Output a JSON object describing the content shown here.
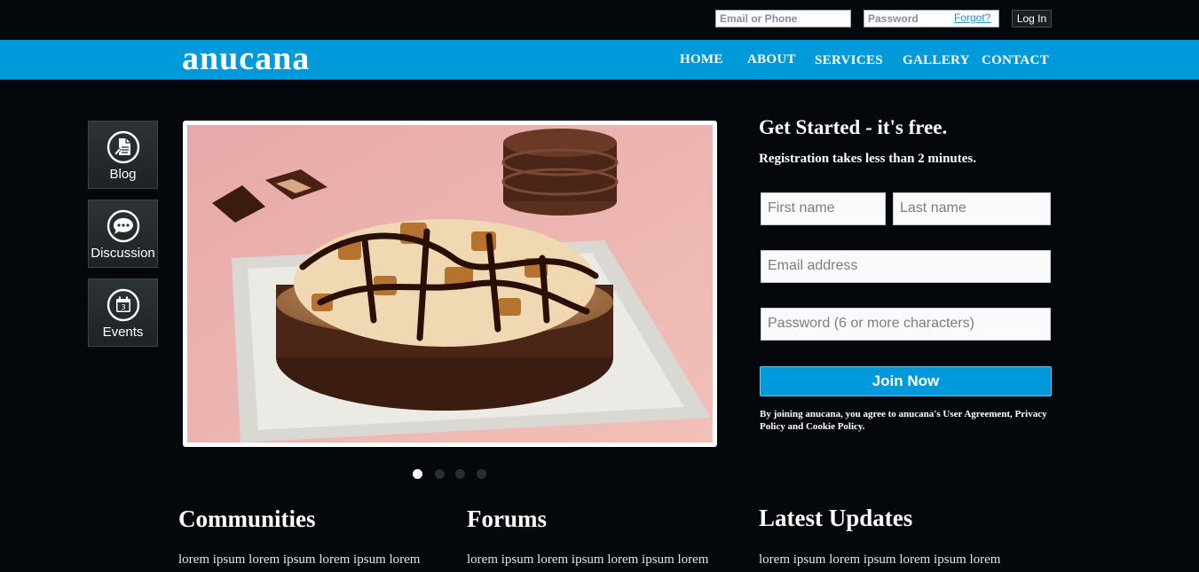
{
  "topbar": {
    "email_placeholder": "Email or Phone",
    "password_placeholder": "Password",
    "forgot_label": "Forgot?",
    "login_label": "Log In"
  },
  "navbar": {
    "logo": "anucana",
    "items": [
      "HOME",
      "ABOUT",
      "SERVICES",
      "GALLERY",
      "CONTACT"
    ]
  },
  "sidebar": {
    "tiles": [
      {
        "label": "Blog",
        "icon": "blog-document-icon"
      },
      {
        "label": "Discussion",
        "icon": "chat-bubble-icon"
      },
      {
        "label": "Events",
        "icon": "calendar-icon"
      }
    ]
  },
  "hero": {
    "image": "chocolate-brownie-photo",
    "slides": 4,
    "active_slide": 1
  },
  "registration": {
    "title": "Get Started - it's free.",
    "subtitle": "Registration takes less than 2 minutes.",
    "first_name_placeholder": "First name",
    "last_name_placeholder": "Last name",
    "email_placeholder": "Email address",
    "password_placeholder": "Password (6 or more characters)",
    "join_label": "Join Now",
    "terms": "By joining anucana, you agree to anucana's User Agreement, Privacy Policy and Cookie Policy."
  },
  "sections": [
    {
      "title": "Communities",
      "text": "lorem ipsum lorem ipsum lorem ipsum lorem"
    },
    {
      "title": "Forums",
      "text": "lorem ipsum lorem ipsum lorem ipsum lorem"
    },
    {
      "title": "Latest Updates",
      "text": "lorem ipsum lorem ipsum lorem ipsum lorem"
    }
  ],
  "colors": {
    "background": "#04080d",
    "nav_blue": "#0099d9",
    "button_blue": "#0099dc",
    "link_blue": "#1f8ed6"
  }
}
